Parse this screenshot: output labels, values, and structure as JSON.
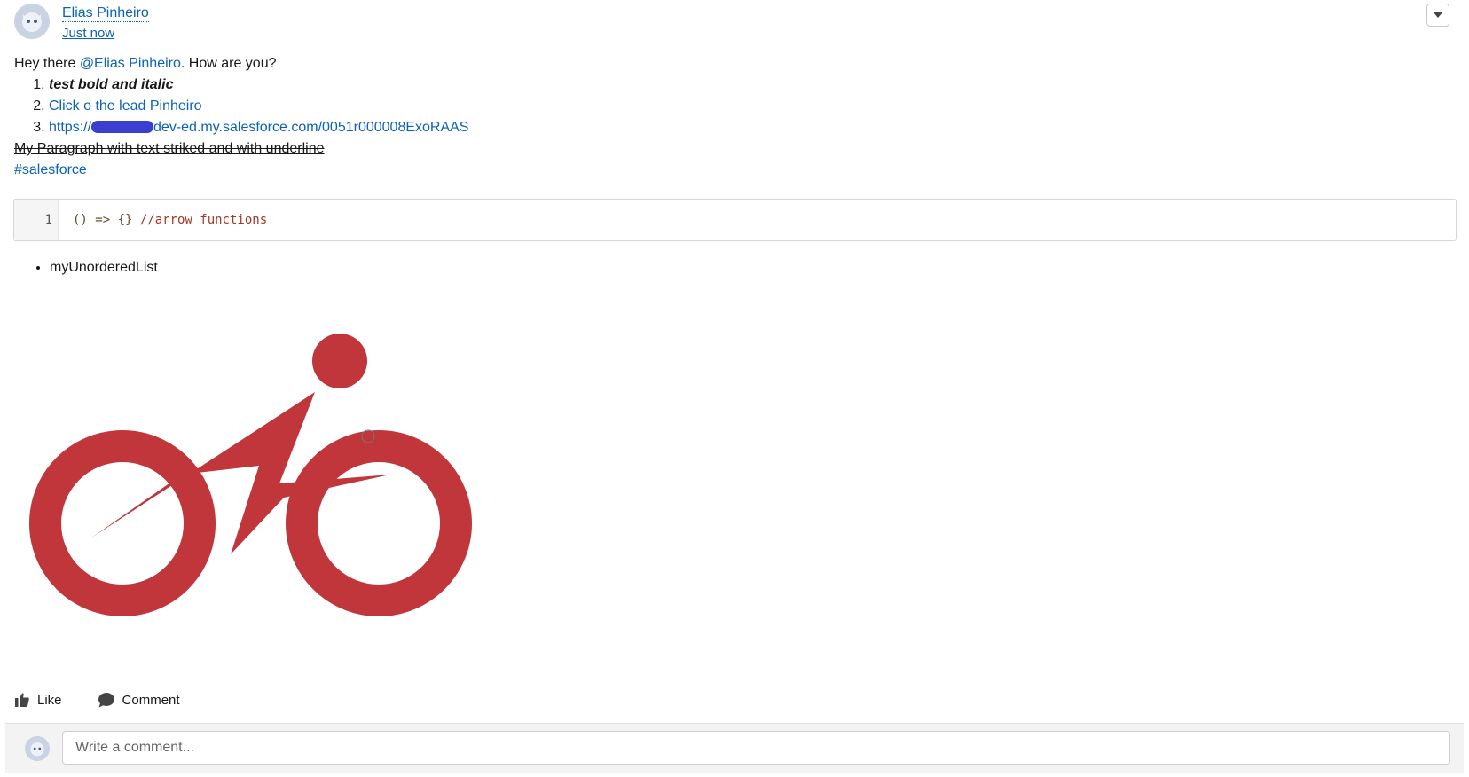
{
  "post": {
    "author": "Elias Pinheiro",
    "timestamp": "Just now"
  },
  "content": {
    "greeting_prefix": "Hey there ",
    "mention": "@Elias Pinheiro",
    "greeting_suffix": ". How are you?",
    "ordered_list": [
      "test bold and italic",
      "Click o the lead Pinheiro",
      "https://",
      "dev-ed.my.salesforce.com/0051r000008ExoRAAS"
    ],
    "strike_paragraph": "My Paragraph with text striked and with underline",
    "hashtag": "#salesforce",
    "code": {
      "line_number": "1",
      "code_text": "() => {} ",
      "comment_text": "//arrow functions"
    },
    "unordered_list": [
      "myUnorderedList"
    ]
  },
  "actions": {
    "like_label": "Like",
    "comment_label": "Comment"
  },
  "comment_box": {
    "placeholder": "Write a comment..."
  },
  "colors": {
    "link": "#0b63b5",
    "logo_red": "#c0363a"
  }
}
